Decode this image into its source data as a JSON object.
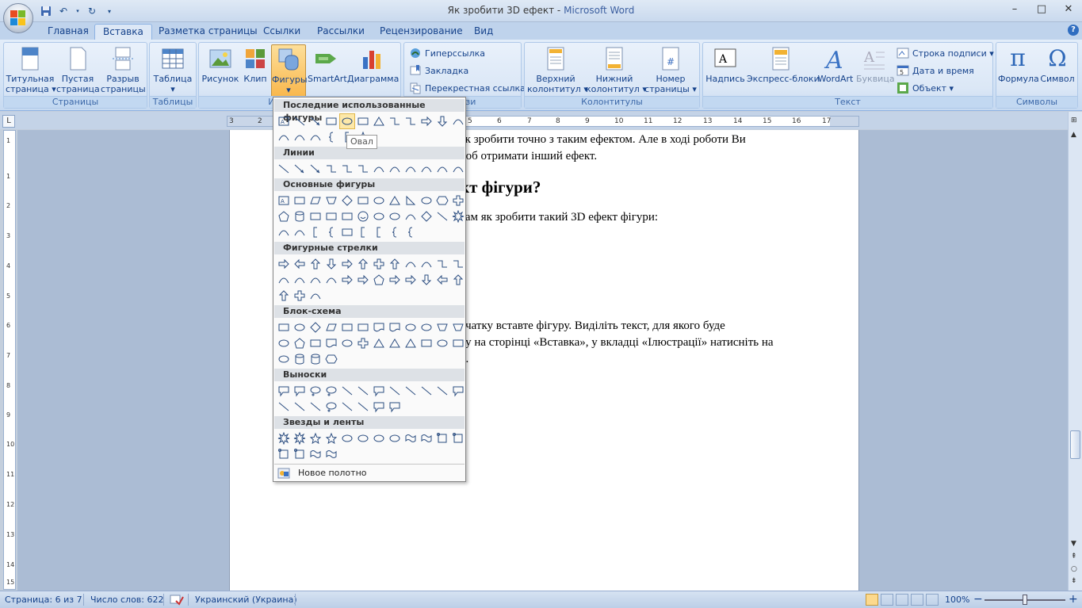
{
  "window": {
    "title_doc": "Як зробити 3D ефект - ",
    "title_app": "Microsoft Word",
    "controls": {
      "minimize": "–",
      "maximize": "□",
      "close": "✕"
    }
  },
  "qat": {
    "save_icon": "save-icon",
    "undo_icon": "undo-icon",
    "redo_icon": "redo-icon"
  },
  "tabs": [
    "Главная",
    "Вставка",
    "Разметка страницы",
    "Ссылки",
    "Рассылки",
    "Рецензирование",
    "Вид"
  ],
  "active_tab": "Вставка",
  "ribbon": {
    "pages": {
      "label": "Страницы",
      "cover1": "Титульная",
      "cover2": "страница ▾",
      "blank1": "Пустая",
      "blank2": "страница",
      "break1": "Разрыв",
      "break2": "страницы"
    },
    "tables": {
      "label": "Таблицы",
      "table": "Таблица",
      "arrow": "▾"
    },
    "illustrations": {
      "label": "Иллюстрации",
      "picture": "Рисунок",
      "clip": "Клип",
      "shapes": "Фигуры",
      "smartart": "SmartArt",
      "chart": "Диаграмма",
      "arrow": "▾"
    },
    "links": {
      "label": "Связи",
      "hyperlink": "Гиперссылка",
      "bookmark": "Закладка",
      "crossref": "Перекрестная ссылка"
    },
    "headerfooter": {
      "label": "Колонтитулы",
      "header1": "Верхний",
      "header2": "колонтитул ▾",
      "footer1": "Нижний",
      "footer2": "колонтитул ▾",
      "pagenum1": "Номер",
      "pagenum2": "страницы ▾"
    },
    "text": {
      "label": "Текст",
      "textbox": "Надпись",
      "quickparts": "Экспресс-блоки",
      "wordart": "WordArt",
      "dropcap": "Буквица",
      "signature": "Строка подписи ▾",
      "datetime": "Дата и время",
      "object": "Объект ▾"
    },
    "symbols": {
      "label": "Символы",
      "equation": "Формула",
      "symbol": "Символ",
      "pi": "π",
      "omega": "Ω"
    }
  },
  "ruler": {
    "tab_selector": "L",
    "h_ticks": [
      "3",
      "2",
      "1",
      "1",
      "2",
      "3",
      "4",
      "5",
      "6",
      "7",
      "8",
      "9",
      "10",
      "11",
      "12",
      "13",
      "14",
      "15",
      "16",
      "17"
    ],
    "v_ticks": [
      "1",
      "1",
      "2",
      "3",
      "4",
      "5",
      "6",
      "7",
      "8",
      "9",
      "10",
      "11",
      "12",
      "13",
      "14",
      "15"
    ]
  },
  "document": {
    "line1": "ак зробити точно з таким ефектом. Але в ході роботи Ви",
    "line2": "доб отримати інший ефект.",
    "heading": "кт фігури?",
    "line3": "вам як зробити такий 3D ефект фігури:",
    "line4": "очатку вставте фігуру. Виділіть текст, для якого буде",
    "line5": "ку на сторінці «Вставка», у вкладці «Ілюстрації» натисніть на",
    "line6": "»."
  },
  "shapes_menu": {
    "recent": "Последние использованные фигуры",
    "lines": "Линии",
    "basic": "Основные фигуры",
    "arrows": "Фигурные стрелки",
    "flowchart": "Блок-схема",
    "callouts": "Выноски",
    "stars": "Звезды и ленты",
    "new_canvas": "Новое полотно",
    "tooltip": "Овал"
  },
  "statusbar": {
    "page": "Страница: 6 из 7",
    "words": "Число слов: 622",
    "language": "Украинский (Украина)",
    "zoom": "100%",
    "zoom_out": "−",
    "zoom_in": "+"
  }
}
